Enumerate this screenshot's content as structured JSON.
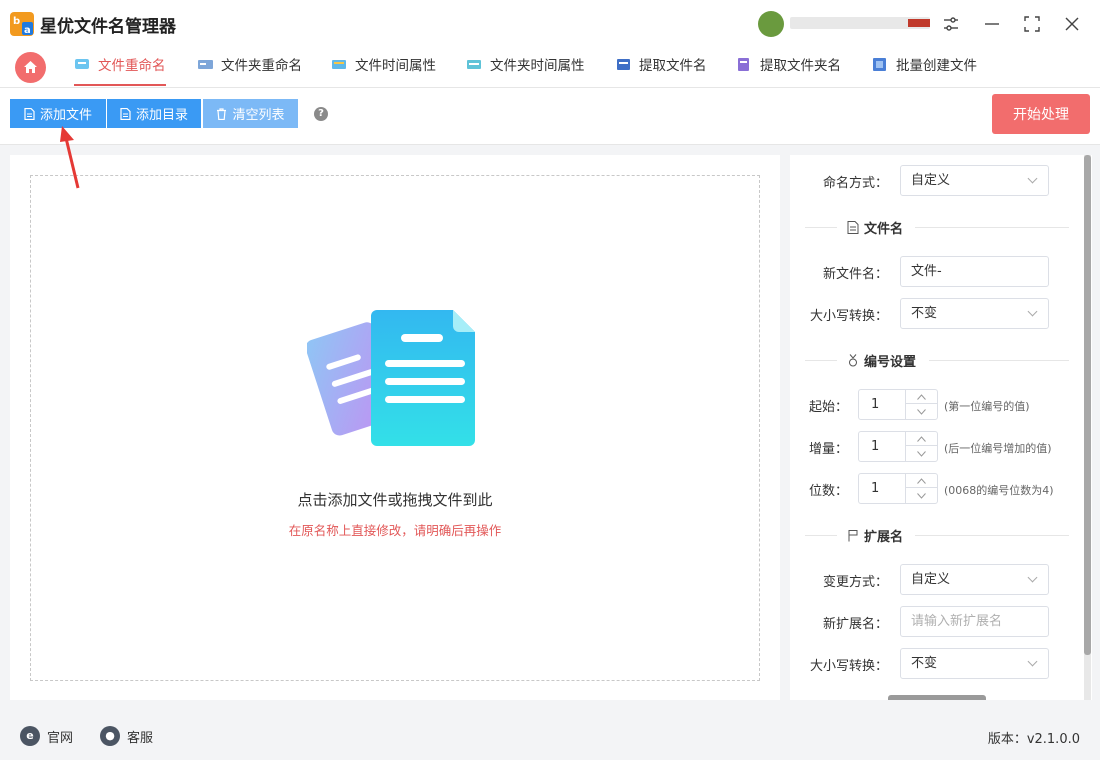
{
  "app": {
    "title": "星优文件名管理器"
  },
  "tabs": [
    {
      "label": "文件重命名",
      "active": true
    },
    {
      "label": "文件夹重命名"
    },
    {
      "label": "文件时间属性"
    },
    {
      "label": "文件夹时间属性"
    },
    {
      "label": "提取文件名"
    },
    {
      "label": "提取文件夹名"
    },
    {
      "label": "批量创建文件"
    }
  ],
  "toolbar": {
    "add_file": "添加文件",
    "add_dir": "添加目录",
    "clear_list": "清空列表",
    "help": "?",
    "start": "开始处理"
  },
  "dropzone": {
    "main_text": "点击添加文件或拖拽文件到此",
    "warning_text": "在原名称上直接修改，请明确后再操作"
  },
  "settings": {
    "naming_mode_label": "命名方式：",
    "naming_mode_value": "自定义",
    "filename_section": "文件名",
    "new_filename_label": "新文件名：",
    "new_filename_value": "文件-",
    "case_label": "大小写转换：",
    "case_value": "不变",
    "numbering_section": "编号设置",
    "start_label": "起始：",
    "start_value": "1",
    "start_hint": "(第一位编号的值)",
    "increment_label": "增量：",
    "increment_value": "1",
    "increment_hint": "(后一位编号增加的值)",
    "digits_label": "位数：",
    "digits_value": "1",
    "digits_hint": "(0068的编号位数为4)",
    "extension_section": "扩展名",
    "change_mode_label": "变更方式：",
    "change_mode_value": "自定义",
    "new_ext_label": "新扩展名：",
    "new_ext_placeholder": "请输入新扩展名",
    "ext_case_label": "大小写转换：",
    "ext_case_value": "不变"
  },
  "status": {
    "website": "官网",
    "support": "客服",
    "version": "版本：v2.1.0.0"
  },
  "colors": {
    "accent_red": "#f26d6d",
    "tab_active": "#e25757",
    "primary_blue": "#3a9af4"
  }
}
